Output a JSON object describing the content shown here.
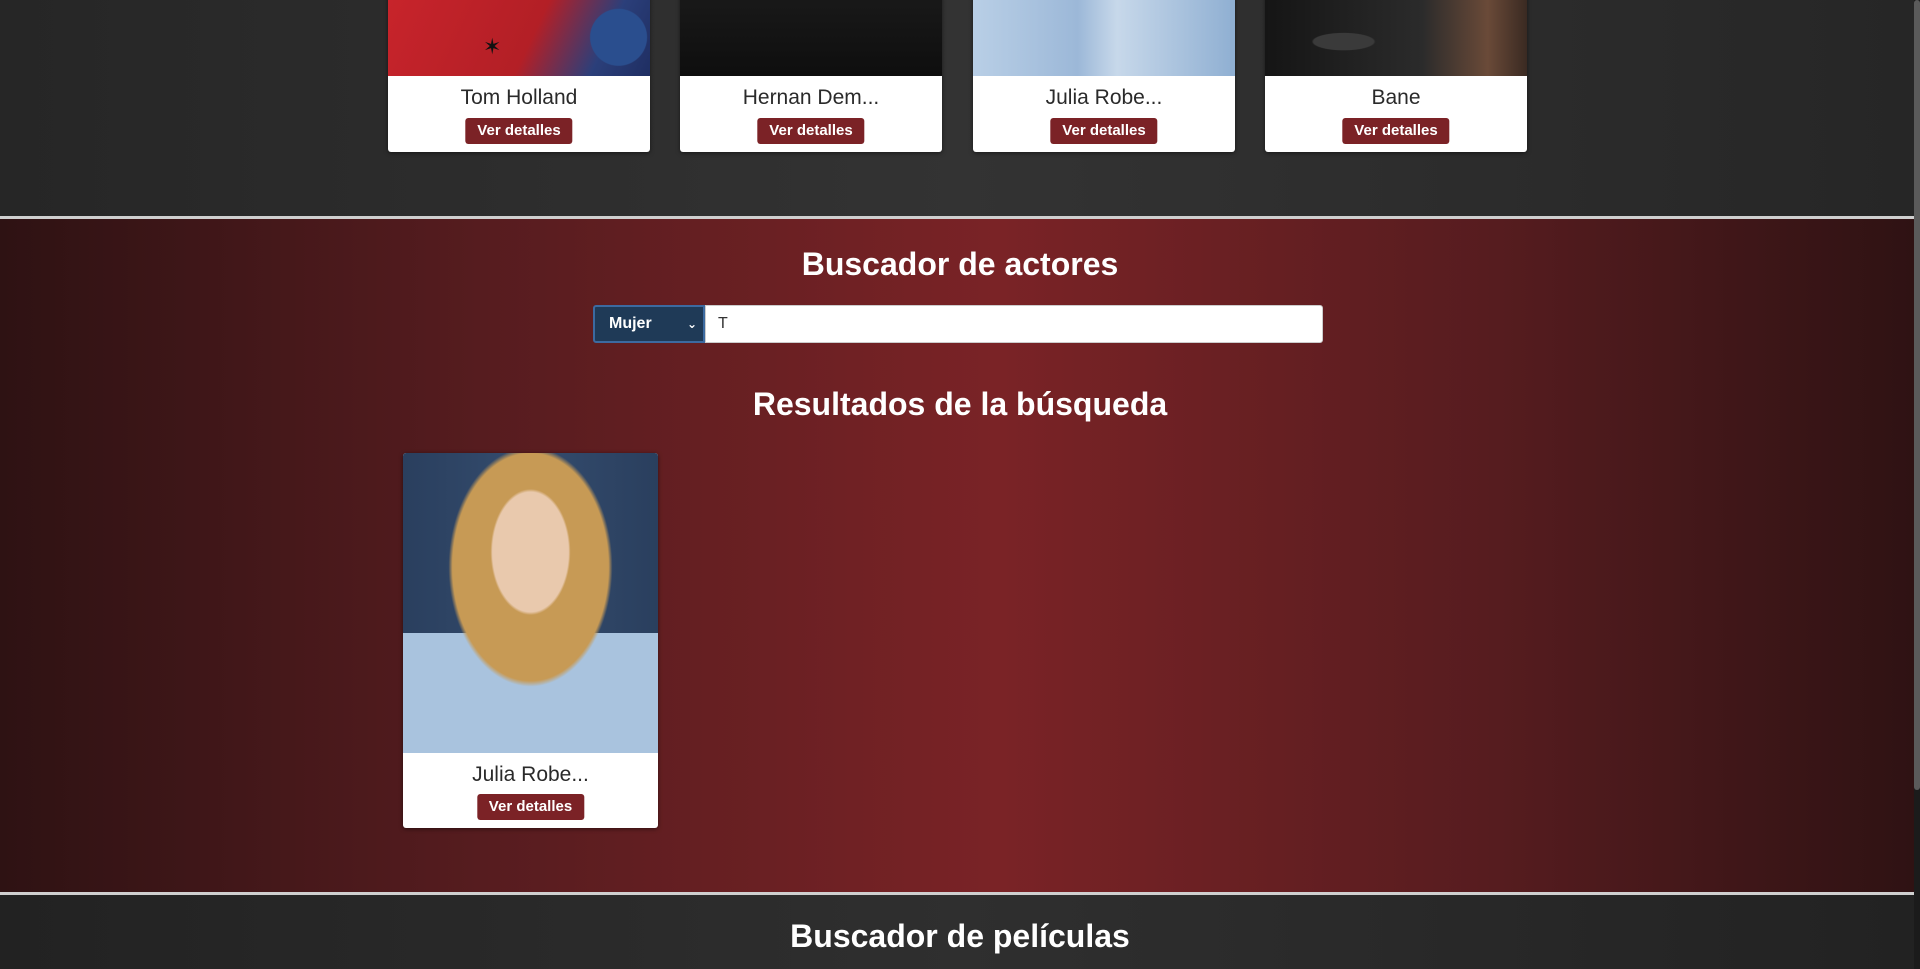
{
  "top_actors": [
    {
      "name": "Tom Holland",
      "button": "Ver detalles"
    },
    {
      "name": "Hernan Dem...",
      "button": "Ver detalles"
    },
    {
      "name": "Julia Robe...",
      "button": "Ver detalles"
    },
    {
      "name": "Bane",
      "button": "Ver detalles"
    }
  ],
  "actor_search": {
    "title": "Buscador de actores",
    "gender_filter": {
      "selected": "Mujer"
    },
    "query": "T",
    "results_title": "Resultados de la búsqueda",
    "results": [
      {
        "name": "Julia Robe...",
        "button": "Ver detalles"
      }
    ]
  },
  "movie_search": {
    "title": "Buscador de películas"
  },
  "colors": {
    "accent": "#7b2226",
    "band_red": "#7a2326",
    "dark_bg": "#262626"
  }
}
